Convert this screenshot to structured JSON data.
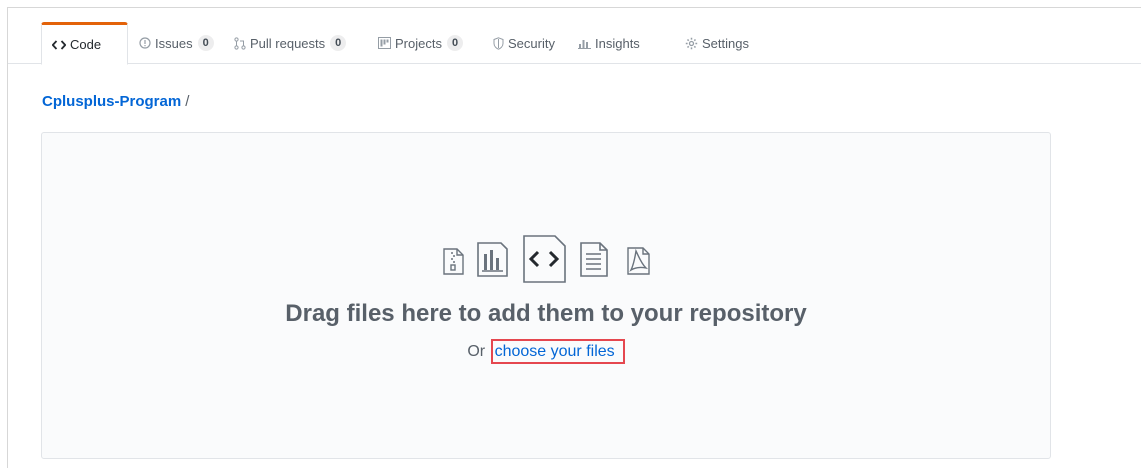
{
  "tabs": [
    {
      "label": "Code",
      "icon": "code-icon",
      "selected": true
    },
    {
      "label": "Issues",
      "icon": "issue-opened-icon",
      "count": "0"
    },
    {
      "label": "Pull requests",
      "icon": "git-pull-request-icon",
      "count": "0"
    },
    {
      "label": "Projects",
      "icon": "project-icon",
      "count": "0"
    },
    {
      "label": "Security",
      "icon": "shield-icon"
    },
    {
      "label": "Insights",
      "icon": "graph-icon"
    },
    {
      "label": "Settings",
      "icon": "gear-icon"
    }
  ],
  "breadcrumb": {
    "repo": "Cplusplus-Program",
    "separator": "/"
  },
  "dropzone": {
    "title": "Drag files here to add them to your repository",
    "prefix": "Or",
    "link": "choose your files",
    "file_icons": [
      "file-zip-icon",
      "file-chart-icon",
      "file-code-icon",
      "file-text-icon",
      "file-pdf-icon"
    ]
  },
  "colors": {
    "accent": "#0366d6",
    "selected_tab_border": "#e36209",
    "highlight_box": "#e5474f"
  }
}
